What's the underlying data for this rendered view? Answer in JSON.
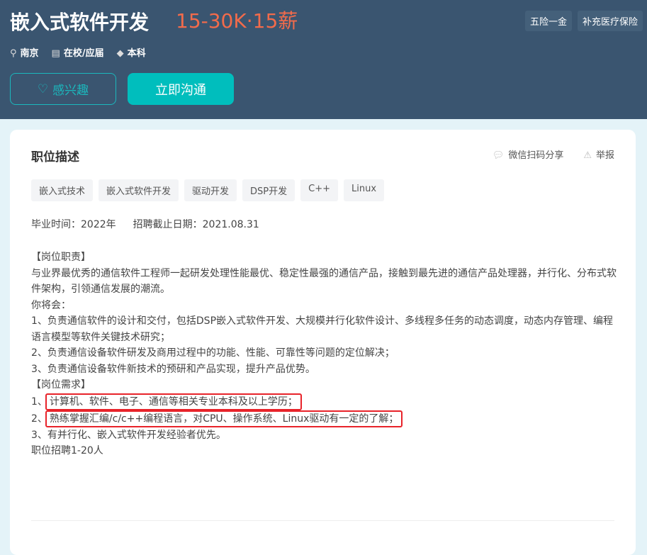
{
  "job": {
    "title": "嵌入式软件开发",
    "salary": "15-30K·15薪",
    "welfare": [
      "五险一金",
      "补充医疗保险"
    ],
    "location": "南京",
    "status": "在校/应届",
    "degree": "本科"
  },
  "buttons": {
    "interest": "感兴趣",
    "chat": "立即沟通"
  },
  "card": {
    "title": "职位描述",
    "share": "微信扫码分享",
    "report": "举报",
    "tags": [
      "嵌入式技术",
      "嵌入式软件开发",
      "驱动开发",
      "DSP开发",
      "C++",
      "Linux"
    ],
    "graduation": "毕业时间：2022年",
    "deadline": "招聘截止日期：2021.08.31",
    "lines": [
      "【岗位职责】",
      "与业界最优秀的通信软件工程师一起研发处理性能最优、稳定性最强的通信产品，接触到最先进的通信产品处理器，并行化、分布式软件架构，引领通信发展的潮流。",
      "你将会：",
      "1、负责通信软件的设计和交付，包括DSP嵌入式软件开发、大规模并行化软件设计、多线程多任务的动态调度，动态内存管理、编程语言模型等软件关键技术研究；",
      "2、负责通信设备软件研发及商用过程中的功能、性能、可靠性等问题的定位解决；",
      "3、负责通信设备软件新技术的预研和产品实现，提升产品优势。",
      "【岗位需求】"
    ],
    "req1_prefix": "1、",
    "req1": "计算机、软件、电子、通信等相关专业本科及以上学历；",
    "req2_prefix": "2、",
    "req2": "熟练掌握汇编/c/c++编程语言，对CPU、操作系统、Linux驱动有一定的了解；",
    "req3": "3、有并行化、嵌入式软件开发经验者优先。",
    "count": "职位招聘1-20人"
  }
}
